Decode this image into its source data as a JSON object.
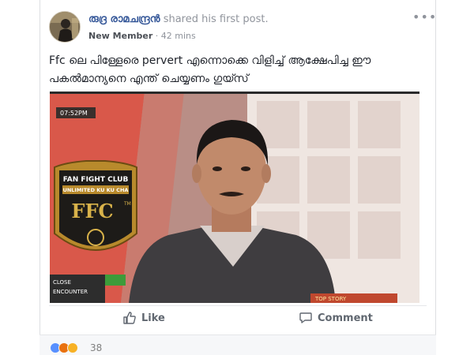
{
  "post": {
    "author": "രുദ്ര രാമചന്ദ്രൻ",
    "action": "shared his first post.",
    "badge": "New Member",
    "separator": "·",
    "time": "42 mins",
    "text_line1": "Ffc ലെ പിള്ളേരെ pervert എന്നൊക്കെ വിളിച്ച് ആക്ഷേപിച്ച ഈ",
    "text_line2": "പകൽമാന്യനെ എന്ത് ചെയ്യണം ഗുയ്സ്"
  },
  "media": {
    "timestamp": "07:52PM",
    "logo_top": "FAN FIGHT CLUB",
    "logo_sub": "UNLIMITED KU KU CHA",
    "logo_letters": "FFC",
    "logo_mark": "TM",
    "ticker_left": "CLOSE",
    "ticker_left2": "ENCOUNTER",
    "ticker_right": "TOP STORY"
  },
  "actions": {
    "like_label": "Like",
    "comment_label": "Comment"
  },
  "reactions": {
    "count": "38",
    "icons": [
      "like-reaction",
      "angry-reaction",
      "haha-reaction"
    ]
  },
  "colors": {
    "link": "#365899",
    "meta": "#90949c",
    "like_blue": "#5890ff",
    "angry": "#e9710f",
    "haha": "#f7b125"
  }
}
